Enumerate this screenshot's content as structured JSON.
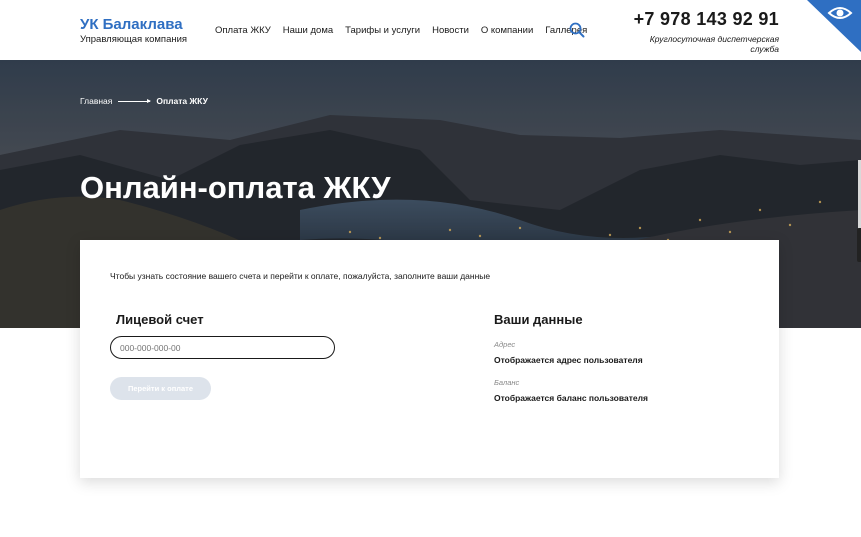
{
  "header": {
    "logo_title": "УК Балаклава",
    "logo_subtitle": "Управляющая компания",
    "nav": [
      "Оплата ЖКУ",
      "Наши дома",
      "Тарифы и услуги",
      "Новости",
      "О компании",
      "Галлерея"
    ],
    "search_icon": "search-icon",
    "phone": "+7 978 143 92 91",
    "phone_note": "Круглосуточная диспетчерская служба",
    "accessibility_icon": "eye-icon",
    "accent_color": "#2f6fc2"
  },
  "breadcrumb": {
    "home": "Главная",
    "current": "Оплата ЖКУ"
  },
  "hero": {
    "title": "Онлайн-оплата ЖКУ"
  },
  "form": {
    "intro": "Чтобы узнать состояние вашего счета и перейти к оплате, пожалуйста, заполните ваши данные",
    "account_title": "Лицевой счет",
    "account_placeholder": "000-000-000-00",
    "pay_button": "Перейти к оплате",
    "your_data_title": "Ваши данные",
    "address_label": "Адрес",
    "address_value": "Отображается адрес пользователя",
    "balance_label": "Баланс",
    "balance_value": "Отображается баланс пользователя"
  }
}
